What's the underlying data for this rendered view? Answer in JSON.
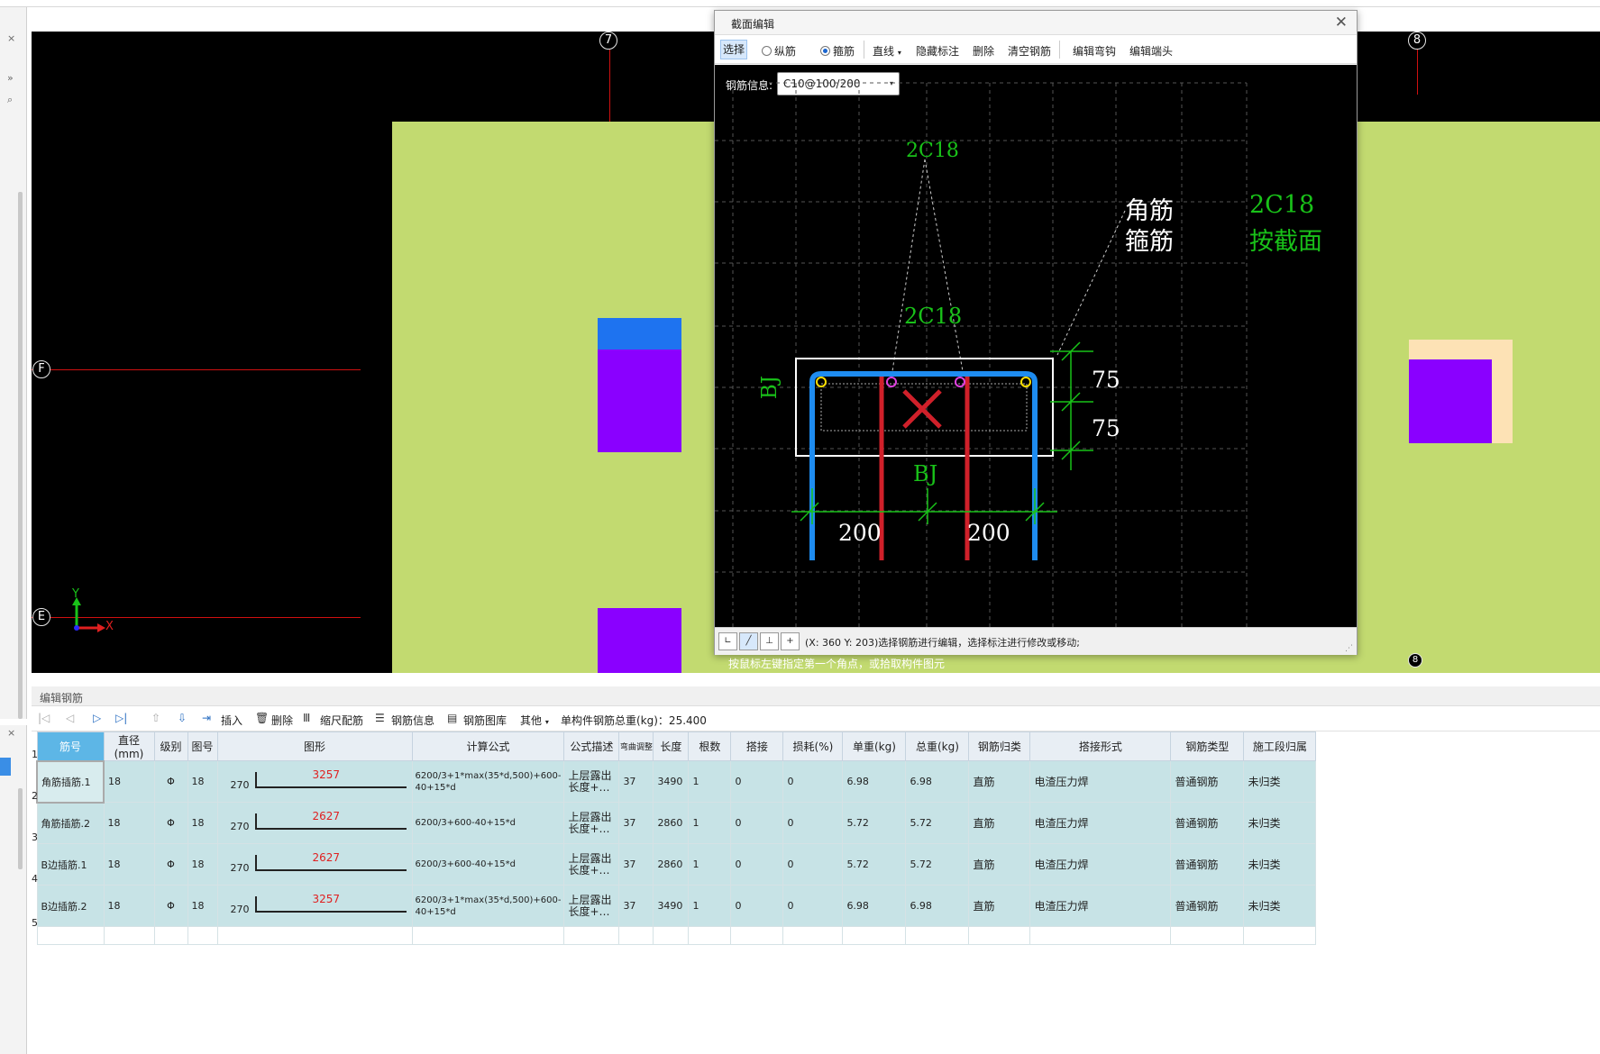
{
  "canvas": {
    "axis_labels": {
      "top_left": "7",
      "top_right": "8",
      "left_upper": "F",
      "left_lower": "E",
      "bottom_right": "8"
    },
    "coord_x": "X",
    "coord_y": "Y",
    "colors": {
      "wall": "#c2da70",
      "column_blue": "#1e73f0",
      "column_purple": "#8a00ff",
      "beige": "#fde2b5",
      "axis_red": "#d01010"
    }
  },
  "dialog": {
    "title": "截面编辑",
    "toolbar": {
      "select": "选择",
      "longitudinal": "纵筋",
      "stirrup": "箍筋",
      "line": "直线",
      "hide_annotation": "隐藏标注",
      "delete": "删除",
      "clear_rebar": "清空钢筋",
      "edit_hook": "编辑弯钩",
      "edit_end": "编辑端头"
    },
    "rebar_info_label": "钢筋信息:",
    "rebar_info_value": "C10@100/200",
    "drawing": {
      "top_label": "2C18",
      "mid_label": "2C18",
      "corner_bar": "角筋",
      "stirrup_label": "箍筋",
      "right_label1": "2C18",
      "right_label2": "按截面",
      "side_left": "BJ",
      "side_bottom": "BJ",
      "dim_75_top": "75",
      "dim_75_bottom": "75",
      "dim_200_left": "200",
      "dim_200_right": "200"
    },
    "status_text": "(X: 360 Y: 203)选择钢筋进行编辑，选择标注进行修改或移动;"
  },
  "hint": "按鼠标左键指定第一个角点，或拾取构件图元",
  "edit_panel": {
    "title": "编辑钢筋",
    "toolbar": {
      "insert": "插入",
      "delete": "删除",
      "scale": "缩尺配筋",
      "rebar_info": "钢筋信息",
      "rebar_lib": "钢筋图库",
      "other": "其他",
      "total_weight": "单构件钢筋总重(kg)：25.400"
    },
    "columns": [
      "筋号",
      "直径(mm)",
      "级别",
      "图号",
      "图形",
      "计算公式",
      "公式描述",
      "弯曲调整",
      "长度",
      "根数",
      "搭接",
      "损耗(%)",
      "单重(kg)",
      "总重(kg)",
      "钢筋归类",
      "搭接形式",
      "钢筋类型",
      "施工段归属"
    ],
    "rows": [
      {
        "num": "1",
        "name": "角筋插筋.1",
        "dia": "18",
        "grade": "Φ",
        "fig": "18",
        "left": "270",
        "len_in_shape": "3257",
        "formula": "6200/3+1*max(35*d,500)+600-40+15*d",
        "desc": "上层露出长度+…",
        "bend": "37",
        "length": "3490",
        "count": "1",
        "lap": "0",
        "loss": "0",
        "unit_w": "6.98",
        "total_w": "6.98",
        "category": "直筋",
        "lap_type": "电渣压力焊",
        "type": "普通钢筋",
        "section": "未归类"
      },
      {
        "num": "2",
        "name": "角筋插筋.2",
        "dia": "18",
        "grade": "Φ",
        "fig": "18",
        "left": "270",
        "len_in_shape": "2627",
        "formula": "6200/3+600-40+15*d",
        "desc": "上层露出长度+…",
        "bend": "37",
        "length": "2860",
        "count": "1",
        "lap": "0",
        "loss": "0",
        "unit_w": "5.72",
        "total_w": "5.72",
        "category": "直筋",
        "lap_type": "电渣压力焊",
        "type": "普通钢筋",
        "section": "未归类"
      },
      {
        "num": "3",
        "name": "B边插筋.1",
        "dia": "18",
        "grade": "Φ",
        "fig": "18",
        "left": "270",
        "len_in_shape": "2627",
        "formula": "6200/3+600-40+15*d",
        "desc": "上层露出长度+…",
        "bend": "37",
        "length": "2860",
        "count": "1",
        "lap": "0",
        "loss": "0",
        "unit_w": "5.72",
        "total_w": "5.72",
        "category": "直筋",
        "lap_type": "电渣压力焊",
        "type": "普通钢筋",
        "section": "未归类"
      },
      {
        "num": "4",
        "name": "B边插筋.2",
        "dia": "18",
        "grade": "Φ",
        "fig": "18",
        "left": "270",
        "len_in_shape": "3257",
        "formula": "6200/3+1*max(35*d,500)+600-40+15*d",
        "desc": "上层露出长度+…",
        "bend": "37",
        "length": "3490",
        "count": "1",
        "lap": "0",
        "loss": "0",
        "unit_w": "6.98",
        "total_w": "6.98",
        "category": "直筋",
        "lap_type": "电渣压力焊",
        "type": "普通钢筋",
        "section": "未归类"
      }
    ],
    "empty_row_num": "5"
  }
}
